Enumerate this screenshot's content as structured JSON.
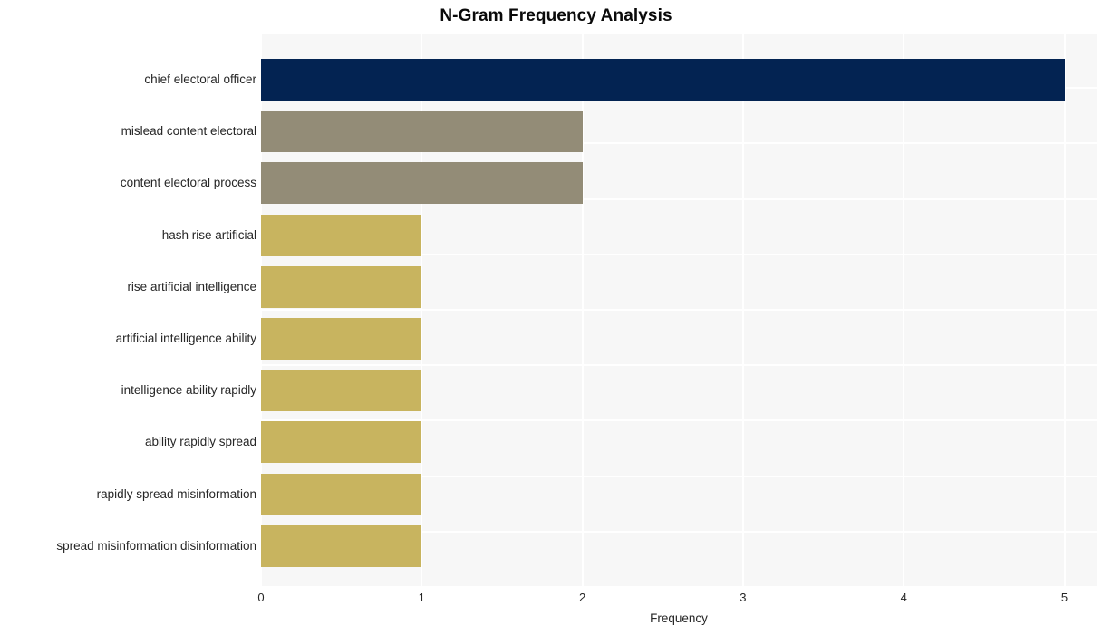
{
  "chart_data": {
    "type": "bar",
    "orientation": "horizontal",
    "title": "N-Gram Frequency Analysis",
    "xlabel": "Frequency",
    "ylabel": "",
    "xlim": [
      0,
      5.2
    ],
    "xticks": [
      "0",
      "1",
      "2",
      "3",
      "4",
      "5"
    ],
    "xtick_values": [
      0,
      1,
      2,
      3,
      4,
      5
    ],
    "grid": true,
    "grid_axis": "both",
    "legend": "none",
    "categories": [
      "chief electoral officer",
      "mislead content electoral",
      "content electoral process",
      "hash rise artificial",
      "rise artificial intelligence",
      "artificial intelligence ability",
      "intelligence ability rapidly",
      "ability rapidly spread",
      "rapidly spread misinformation",
      "spread misinformation disinformation"
    ],
    "values": [
      5,
      2,
      2,
      1,
      1,
      1,
      1,
      1,
      1,
      1
    ],
    "bar_colors": [
      "#032352",
      "#938c77",
      "#938c77",
      "#c8b45f",
      "#c8b45f",
      "#c8b45f",
      "#c8b45f",
      "#c8b45f",
      "#c8b45f",
      "#c8b45f"
    ]
  },
  "style": {
    "figure_background": "#ffffff",
    "plot_background": "#f7f7f7",
    "gridline_color": "#ffffff",
    "title_color": "#0a0a0a",
    "tick_label_color": "#262626"
  }
}
